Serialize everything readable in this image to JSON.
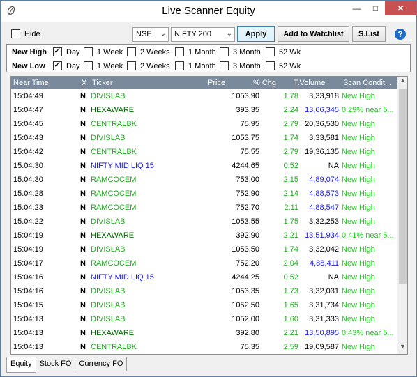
{
  "window": {
    "title": "Live Scanner Equity"
  },
  "toolbar": {
    "hide_label": "Hide",
    "hide_checked": false,
    "exchange": "NSE",
    "index": "NIFTY 200",
    "apply_label": "Apply",
    "watchlist_label": "Add to Watchlist",
    "slist_label": "S.List",
    "help_glyph": "?"
  },
  "filters": {
    "new_high": {
      "label": "New High",
      "options": [
        {
          "label": "Day",
          "checked": true
        },
        {
          "label": "1 Week",
          "checked": false
        },
        {
          "label": "2 Weeks",
          "checked": false
        },
        {
          "label": "1 Month",
          "checked": false
        },
        {
          "label": "3 Month",
          "checked": false
        },
        {
          "label": "52 Wk",
          "checked": false
        }
      ]
    },
    "new_low": {
      "label": "New Low",
      "options": [
        {
          "label": "Day",
          "checked": true
        },
        {
          "label": "1 Week",
          "checked": false
        },
        {
          "label": "2 Weeks",
          "checked": false
        },
        {
          "label": "1 Month",
          "checked": false
        },
        {
          "label": "3 Month",
          "checked": false
        },
        {
          "label": "52 Wk",
          "checked": false
        }
      ]
    }
  },
  "table": {
    "columns": [
      "Near Time",
      "X",
      "Ticker",
      "Price",
      "% Chg",
      "T.Volume",
      "Scan Condit..."
    ],
    "rows": [
      {
        "time": "15:04:49",
        "x": "N",
        "ticker": "DIVISLAB",
        "price": "1053.90",
        "chg": "1.78",
        "vol": "3,33,918",
        "scan": "New High",
        "tcolor": "green",
        "vcolor": "black"
      },
      {
        "time": "15:04:47",
        "x": "N",
        "ticker": "HEXAWARE",
        "price": "393.35",
        "chg": "2.24",
        "vol": "13,66,345",
        "scan": "0.29% near 5...",
        "tcolor": "darkgreen",
        "vcolor": "blue"
      },
      {
        "time": "15:04:45",
        "x": "N",
        "ticker": "CENTRALBK",
        "price": "75.95",
        "chg": "2.79",
        "vol": "20,36,530",
        "scan": "New High",
        "tcolor": "green",
        "vcolor": "black"
      },
      {
        "time": "15:04:43",
        "x": "N",
        "ticker": "DIVISLAB",
        "price": "1053.75",
        "chg": "1.74",
        "vol": "3,33,581",
        "scan": "New High",
        "tcolor": "green",
        "vcolor": "black"
      },
      {
        "time": "15:04:42",
        "x": "N",
        "ticker": "CENTRALBK",
        "price": "75.55",
        "chg": "2.79",
        "vol": "19,36,135",
        "scan": "New High",
        "tcolor": "green",
        "vcolor": "black"
      },
      {
        "time": "15:04:30",
        "x": "N",
        "ticker": "NIFTY MID LIQ 15",
        "price": "4244.65",
        "chg": "0.52",
        "vol": "NA",
        "scan": "New High",
        "tcolor": "blue",
        "vcolor": "black"
      },
      {
        "time": "15:04:30",
        "x": "N",
        "ticker": "RAMCOCEM",
        "price": "753.00",
        "chg": "2.15",
        "vol": "4,89,074",
        "scan": "New High",
        "tcolor": "green",
        "vcolor": "blue"
      },
      {
        "time": "15:04:28",
        "x": "N",
        "ticker": "RAMCOCEM",
        "price": "752.90",
        "chg": "2.14",
        "vol": "4,88,573",
        "scan": "New High",
        "tcolor": "green",
        "vcolor": "blue"
      },
      {
        "time": "15:04:23",
        "x": "N",
        "ticker": "RAMCOCEM",
        "price": "752.70",
        "chg": "2.11",
        "vol": "4,88,547",
        "scan": "New High",
        "tcolor": "green",
        "vcolor": "blue"
      },
      {
        "time": "15:04:22",
        "x": "N",
        "ticker": "DIVISLAB",
        "price": "1053.55",
        "chg": "1.75",
        "vol": "3,32,253",
        "scan": "New High",
        "tcolor": "green",
        "vcolor": "black"
      },
      {
        "time": "15:04:19",
        "x": "N",
        "ticker": "HEXAWARE",
        "price": "392.90",
        "chg": "2.21",
        "vol": "13,51,934",
        "scan": "0.41% near 5...",
        "tcolor": "darkgreen",
        "vcolor": "blue"
      },
      {
        "time": "15:04:19",
        "x": "N",
        "ticker": "DIVISLAB",
        "price": "1053.50",
        "chg": "1.74",
        "vol": "3,32,042",
        "scan": "New High",
        "tcolor": "green",
        "vcolor": "black"
      },
      {
        "time": "15:04:17",
        "x": "N",
        "ticker": "RAMCOCEM",
        "price": "752.20",
        "chg": "2.04",
        "vol": "4,88,411",
        "scan": "New High",
        "tcolor": "green",
        "vcolor": "blue"
      },
      {
        "time": "15:04:16",
        "x": "N",
        "ticker": "NIFTY MID LIQ 15",
        "price": "4244.25",
        "chg": "0.52",
        "vol": "NA",
        "scan": "New High",
        "tcolor": "blue",
        "vcolor": "black"
      },
      {
        "time": "15:04:16",
        "x": "N",
        "ticker": "DIVISLAB",
        "price": "1053.35",
        "chg": "1.73",
        "vol": "3,32,031",
        "scan": "New High",
        "tcolor": "green",
        "vcolor": "black"
      },
      {
        "time": "15:04:15",
        "x": "N",
        "ticker": "DIVISLAB",
        "price": "1052.50",
        "chg": "1.65",
        "vol": "3,31,734",
        "scan": "New High",
        "tcolor": "green",
        "vcolor": "black"
      },
      {
        "time": "15:04:13",
        "x": "N",
        "ticker": "DIVISLAB",
        "price": "1052.00",
        "chg": "1.60",
        "vol": "3,31,333",
        "scan": "New High",
        "tcolor": "green",
        "vcolor": "black"
      },
      {
        "time": "15:04:13",
        "x": "N",
        "ticker": "HEXAWARE",
        "price": "392.80",
        "chg": "2.21",
        "vol": "13,50,895",
        "scan": "0.43% near 5...",
        "tcolor": "darkgreen",
        "vcolor": "blue"
      },
      {
        "time": "15:04:13",
        "x": "N",
        "ticker": "CENTRALBK",
        "price": "75.35",
        "chg": "2.59",
        "vol": "19,09,587",
        "scan": "New High",
        "tcolor": "green",
        "vcolor": "black"
      }
    ]
  },
  "tabs": [
    {
      "label": "Equity",
      "active": true
    },
    {
      "label": "Stock FO",
      "active": false
    },
    {
      "label": "Currency FO",
      "active": false
    }
  ],
  "colors": {
    "green": "#22aa22",
    "darkgreen": "#006400",
    "blue": "#1a1ae6",
    "black": "#000000",
    "chg": "#22aa22",
    "scan": "#22cc22",
    "header_bg": "#7a8a9c"
  }
}
